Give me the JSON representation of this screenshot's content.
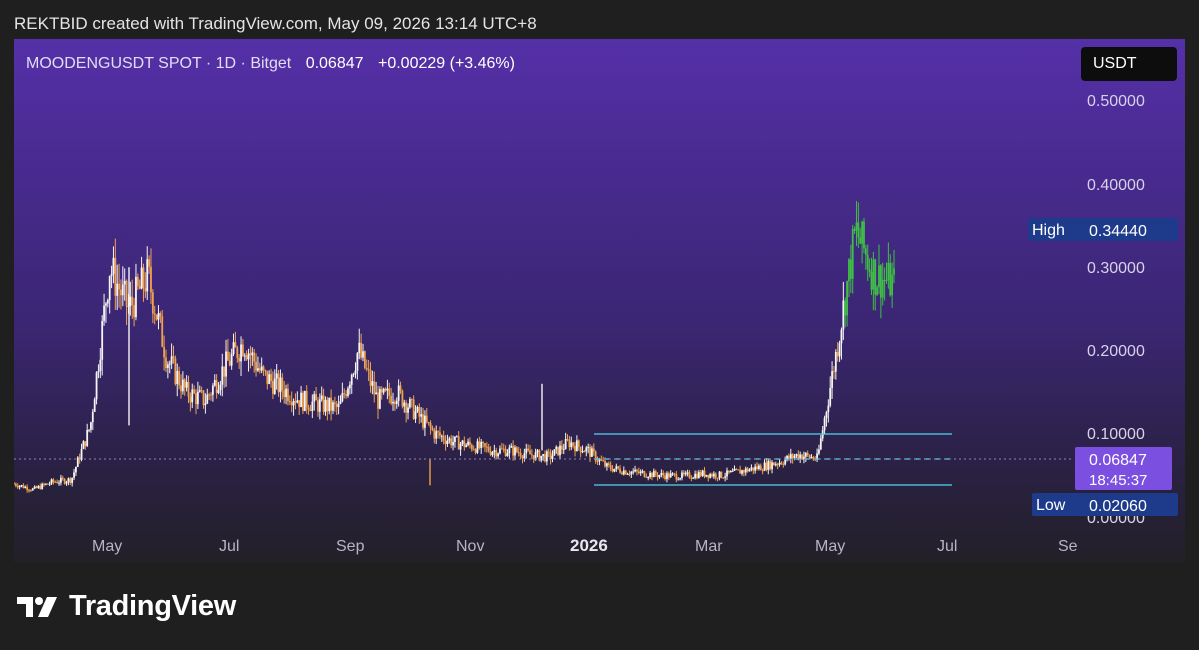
{
  "header": {
    "credit": "REKTBID created with TradingView.com, May 09, 2026 13:14 UTC+8"
  },
  "legend": {
    "symbol": "MOODENGUSDT SPOT · 1D · Bitget",
    "price": "0.06847",
    "change": "+0.00229 (+3.46%)"
  },
  "currency_button": "USDT",
  "price_tag": {
    "price": "0.06847",
    "countdown": "18:45:37"
  },
  "high_marker": {
    "label": "High",
    "value": "0.34440"
  },
  "low_marker": {
    "label": "Low",
    "value": "0.02060"
  },
  "brand": "TradingView",
  "colors": {
    "candle_orange": "#f0a24e",
    "candle_white": "#f5f5f5",
    "candle_green": "#3fbf45",
    "range_lines": "#4fd6f2",
    "tag_purple": "#7b4fe0",
    "marker_blue": "#1e3a8a"
  },
  "chart_data": {
    "type": "candlestick",
    "title": "MOODENGUSDT SPOT · 1D · Bitget",
    "y_ticks": [
      "0.50000",
      "0.40000",
      "0.30000",
      "0.20000",
      "0.10000"
    ],
    "x_ticks": [
      "May",
      "Jul",
      "Sep",
      "Nov",
      "2026",
      "Mar",
      "May",
      "Jul",
      "Se"
    ],
    "ylim": [
      0.0,
      0.52
    ],
    "price_line": 0.06847,
    "range_box": {
      "upper": 0.097,
      "lower": 0.037,
      "start": "Jan 2026",
      "end": "Jun 2026"
    },
    "series": [
      {
        "name": "MOODENGUSDT",
        "points": [
          [
            "Mar 2025",
            0.04
          ],
          [
            "Apr 2025",
            0.033
          ],
          [
            "Apr 2025",
            0.042
          ],
          [
            "May 2025",
            0.045
          ],
          [
            "May 2025",
            0.11
          ],
          [
            "May 2025",
            0.3
          ],
          [
            "May 2025",
            0.25
          ],
          [
            "May 2025",
            0.29
          ],
          [
            "Jun 2025",
            0.19
          ],
          [
            "Jun 2025",
            0.15
          ],
          [
            "Jun 2025",
            0.14
          ],
          [
            "Jul 2025",
            0.18
          ],
          [
            "Jul 2025",
            0.21
          ],
          [
            "Jul 2025",
            0.17
          ],
          [
            "Aug 2025",
            0.155
          ],
          [
            "Aug 2025",
            0.14
          ],
          [
            "Aug 2025",
            0.135
          ],
          [
            "Sep 2025",
            0.13
          ],
          [
            "Sep 2025",
            0.2
          ],
          [
            "Sep 2025",
            0.14
          ],
          [
            "Oct 2025",
            0.15
          ],
          [
            "Oct 2025",
            0.125
          ],
          [
            "Oct 2025",
            0.1
          ],
          [
            "Nov 2025",
            0.09
          ],
          [
            "Nov 2025",
            0.085
          ],
          [
            "Nov 2025",
            0.08
          ],
          [
            "Dec 2025",
            0.08
          ],
          [
            "Dec 2025",
            0.075
          ],
          [
            "Jan 2026",
            0.072
          ],
          [
            "Jan 2026",
            0.09
          ],
          [
            "Jan 2026",
            0.08
          ],
          [
            "Feb 2026",
            0.06
          ],
          [
            "Feb 2026",
            0.055
          ],
          [
            "Feb 2026",
            0.052
          ],
          [
            "Mar 2026",
            0.05
          ],
          [
            "Mar 2026",
            0.049
          ],
          [
            "Mar 2026",
            0.052
          ],
          [
            "Apr 2026",
            0.05
          ],
          [
            "Apr 2026",
            0.055
          ],
          [
            "Apr 2026",
            0.06
          ],
          [
            "May 2026",
            0.066
          ],
          [
            "May 2026",
            0.075
          ],
          [
            "May 2026",
            0.07
          ],
          [
            "May 2026",
            0.2
          ],
          [
            "May 2026",
            0.344
          ],
          [
            "May 2026",
            0.29
          ],
          [
            "May 2026",
            0.28
          ]
        ]
      }
    ]
  }
}
